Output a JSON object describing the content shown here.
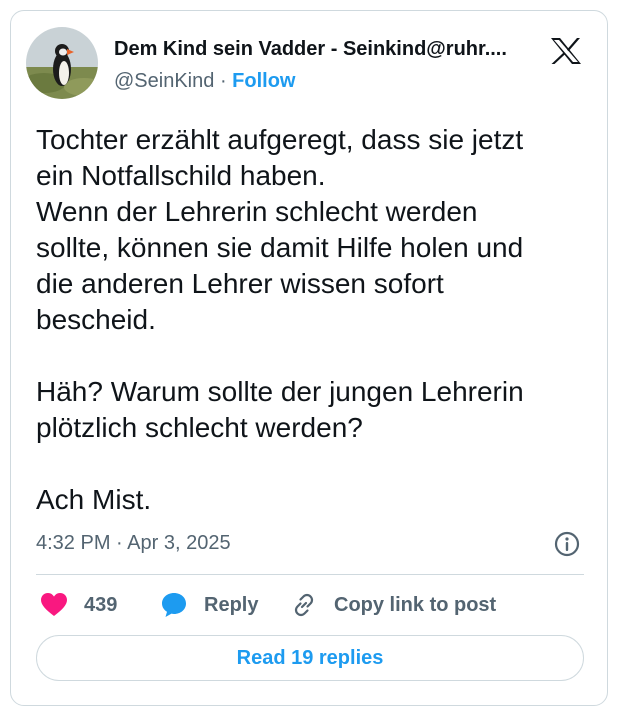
{
  "author": {
    "display_name": "Dem Kind sein Vadder - Seinkind@ruhr....",
    "handle": "@SeinKind",
    "separator": "·",
    "follow_label": "Follow",
    "avatar_icon": "puffin-avatar"
  },
  "platform": {
    "logo_icon": "x-logo-icon"
  },
  "tweet": {
    "text": "Tochter erzählt aufgeregt, dass sie jetzt\nein Notfallschild haben.\nWenn der Lehrerin schlecht werden\nsollte, können sie damit Hilfe holen und\ndie anderen Lehrer wissen sofort\nbescheid.\n\nHäh? Warum sollte der jungen Lehrerin\nplötzlich schlecht werden?\n\nAch Mist.",
    "timestamp": "4:32 PM · Apr 3, 2025"
  },
  "actions": {
    "like_count": "439",
    "reply_label": "Reply",
    "copy_link_label": "Copy link to post",
    "read_replies_label": "Read 19 replies"
  },
  "colors": {
    "accent": "#1d9bf0",
    "like": "#f91880",
    "secondary_text": "#536471",
    "border": "#cfd9de"
  }
}
